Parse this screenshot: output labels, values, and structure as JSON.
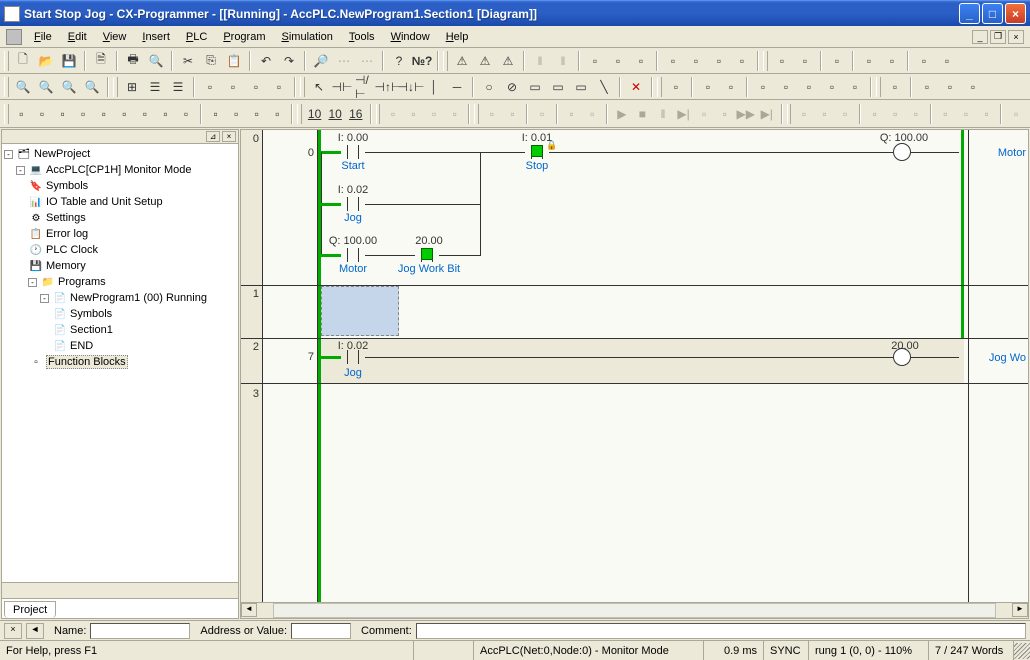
{
  "title": "Start Stop Jog - CX-Programmer - [[Running] - AccPLC.NewProgram1.Section1 [Diagram]]",
  "menus": [
    "File",
    "Edit",
    "View",
    "Insert",
    "PLC",
    "Program",
    "Simulation",
    "Tools",
    "Window",
    "Help"
  ],
  "tree": {
    "root": "NewProject",
    "plc": "AccPLC[CP1H] Monitor Mode",
    "items": [
      "Symbols",
      "IO Table and Unit Setup",
      "Settings",
      "Error log",
      "PLC Clock",
      "Memory",
      "Programs"
    ],
    "program": "NewProgram1 (00) Running",
    "program_children": [
      "Symbols",
      "Section1",
      "END"
    ],
    "after_programs": "Function Blocks",
    "tab": "Project"
  },
  "ladder": {
    "rungs": [
      {
        "num": "0",
        "step": "0"
      },
      {
        "num": "1",
        "step": ""
      },
      {
        "num": "2",
        "step": "7"
      },
      {
        "num": "3",
        "step": ""
      }
    ],
    "elements": {
      "start_addr": "I: 0.00",
      "start_name": "Start",
      "stop_addr": "I: 0.01",
      "stop_name": "Stop",
      "jog_addr": "I: 0.02",
      "jog_name": "Jog",
      "motor_addr": "Q: 100.00",
      "motor_name": "Motor",
      "workbit_addr": "20.00",
      "workbit_name": "Jog Work Bit",
      "jog2_addr": "I: 0.02",
      "jog2_name": "Jog",
      "out2_addr": "20.00",
      "out2_name": "Jog Wo"
    }
  },
  "info": {
    "name_label": "Name:",
    "addr_label": "Address or Value:",
    "comment_label": "Comment:"
  },
  "status": {
    "help": "For Help, press F1",
    "plc": "AccPLC(Net:0,Node:0) - Monitor Mode",
    "time": "0.9 ms",
    "sync": "SYNC",
    "rung": "rung 1 (0, 0) - 110%",
    "words": "7 / 247 Words"
  }
}
